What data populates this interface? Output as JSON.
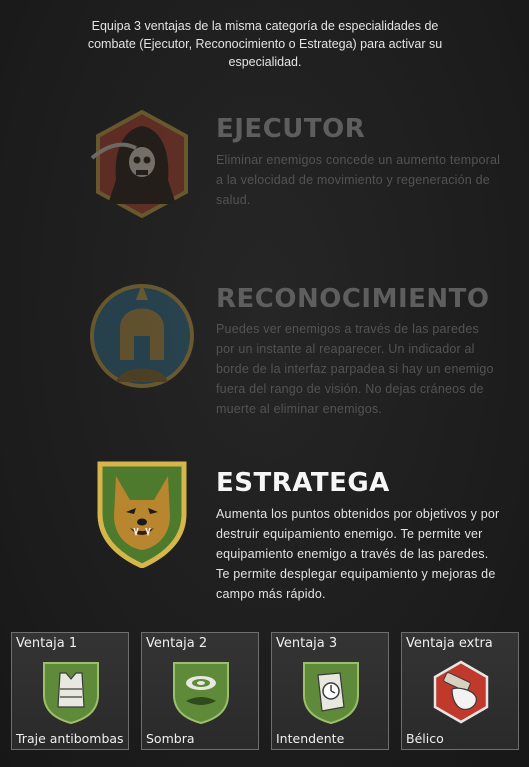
{
  "intro_text": "Equipa 3 ventajas de la misma categoría de especialidades de combate (Ejecutor, Reconocimiento o Estratega) para activar su especialidad.",
  "specialties": [
    {
      "title": "EJECUTOR",
      "description": "Eliminar enemigos concede un aumento temporal a la velocidad de movimiento y regeneración de salud.",
      "emblem": "reaper-icon",
      "active": false
    },
    {
      "title": "RECONOCIMIENTO",
      "description": "Puedes ver enemigos a través de las paredes por un instante al reaparecer. Un indicador al borde de la interfaz parpadea si hay un enemigo fuera del rango de visión. No dejas cráneos de muerte al eliminar enemigos.",
      "emblem": "spartan-helmet-icon",
      "active": false
    },
    {
      "title": "ESTRATEGA",
      "description": "Aumenta los puntos obtenidos por objetivos y por destruir equipamiento enemigo. Te permite ver equipamiento enemigo a través de las paredes. Te permite desplegar equipamiento y mejoras de campo más rápido.",
      "emblem": "wolf-dog-icon",
      "active": true
    }
  ],
  "perks": [
    {
      "slot": "Ventaja 1",
      "name": "Traje antibombas",
      "icon": "vest-icon",
      "color": "#5f8a3a"
    },
    {
      "slot": "Ventaja 2",
      "name": "Sombra",
      "icon": "shadow-icon",
      "color": "#5f8a3a"
    },
    {
      "slot": "Ventaja 3",
      "name": "Intendente",
      "icon": "glove-clock-icon",
      "color": "#5f8a3a"
    },
    {
      "slot": "Ventaja extra",
      "name": "Bélico",
      "icon": "grenade-hand-icon",
      "color": "#c0392b"
    }
  ]
}
